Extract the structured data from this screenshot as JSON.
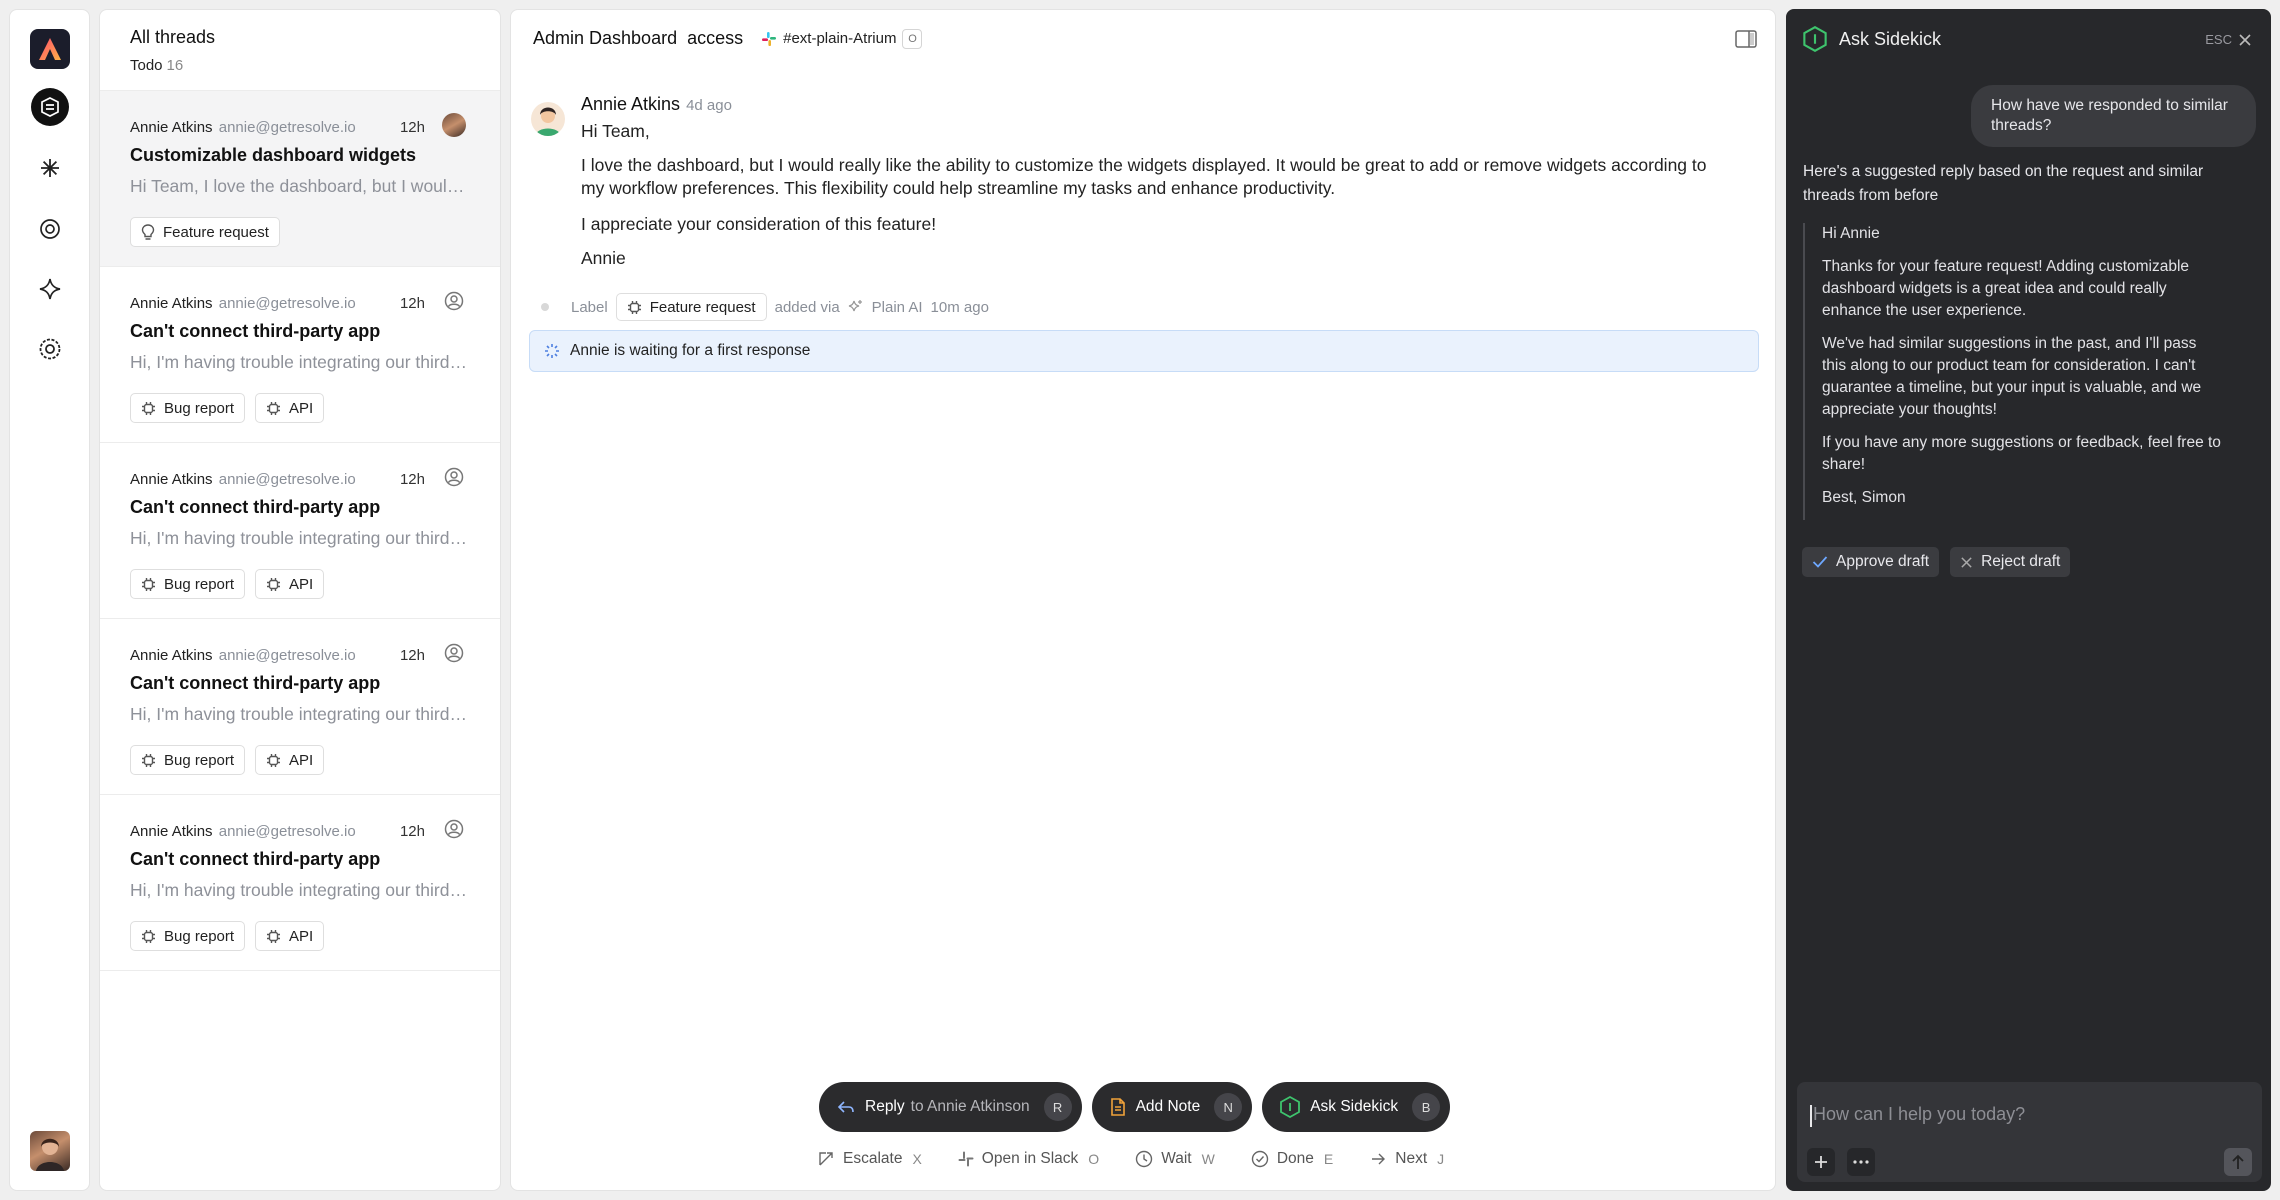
{
  "sidebar": {
    "nav_icons": [
      "logo",
      "inbox-icon",
      "asterisk-icon",
      "gear-icon",
      "sparkle-icon",
      "settings-icon"
    ]
  },
  "threads": {
    "title": "All threads",
    "filter_label": "Todo",
    "filter_count": "16",
    "items": [
      {
        "author": "Annie Atkins",
        "email": "annie@getresolve.io",
        "age": "12h",
        "title": "Customizable dashboard widgets",
        "preview": "Hi Team, I love the dashboard, but I would really like the ability to customize",
        "tags": [
          "Feature request"
        ],
        "selected": true
      },
      {
        "author": "Annie Atkins",
        "email": "annie@getresolve.io",
        "age": "12h",
        "title": "Can't connect third-party app",
        "preview": "Hi, I'm having trouble integrating our third-party app",
        "tags": [
          "Bug report",
          "API"
        ]
      },
      {
        "author": "Annie Atkins",
        "email": "annie@getresolve.io",
        "age": "12h",
        "title": "Can't connect third-party app",
        "preview": "Hi, I'm having trouble integrating our third-party app",
        "tags": [
          "Bug report",
          "API"
        ]
      },
      {
        "author": "Annie Atkins",
        "email": "annie@getresolve.io",
        "age": "12h",
        "title": "Can't connect third-party app",
        "preview": "Hi, I'm having trouble integrating our third-party app",
        "tags": [
          "Bug report",
          "API"
        ]
      },
      {
        "author": "Annie Atkins",
        "email": "annie@getresolve.io",
        "age": "12h",
        "title": "Can't connect third-party app",
        "preview": "Hi, I'm having trouble integrating our third-party app",
        "tags": [
          "Bug report",
          "API"
        ]
      }
    ]
  },
  "conversation": {
    "title": "Admin Dashboard  access",
    "channel": "#ext-plain-Atrium",
    "channel_key": "O",
    "message": {
      "author": "Annie Atkins",
      "ago": "4d ago",
      "greeting": "Hi Team,",
      "para1": "I love the dashboard, but I would really like the ability to customize the widgets displayed. It would be great to add or remove widgets according to my workflow preferences. This flexibility could help streamline my tasks and enhance productivity.",
      "para2": "I appreciate your consideration of this feature!",
      "signoff": "Annie"
    },
    "event": {
      "label": "Label",
      "tag": "Feature request",
      "added_via": "added via",
      "source": "Plain AI",
      "ago": "10m ago"
    },
    "banner": "Annie is waiting for a first response"
  },
  "composer": {
    "reply_label": "Reply",
    "reply_to": "to Annie Atkinson",
    "reply_key": "R",
    "note_label": "Add Note",
    "note_key": "N",
    "sidekick_label": "Ask Sidekick",
    "sidekick_key": "B"
  },
  "actions": [
    {
      "label": "Escalate",
      "key": "X"
    },
    {
      "label": "Open in Slack",
      "key": "O"
    },
    {
      "label": "Wait",
      "key": "W"
    },
    {
      "label": "Done",
      "key": "E"
    },
    {
      "label": "Next",
      "key": "J"
    }
  ],
  "sidekick": {
    "title": "Ask Sidekick",
    "esc": "ESC",
    "user_question": "How have we responded to similar threads?",
    "intro": "Here's a suggested reply based on the request and similar threads from before",
    "draft": [
      "Hi Annie",
      "Thanks for your feature request! Adding customizable dashboard widgets is a great idea and could really enhance the user experience.",
      "We've had similar suggestions in the past, and I'll pass this along to our product team for consideration. I can't guarantee a timeline, but your input is valuable, and we appreciate your thoughts!",
      "If you have any more suggestions or feedback, feel free to share!",
      "Best, Simon"
    ],
    "approve": "Approve draft",
    "reject": "Reject draft",
    "input_placeholder": "How can I help you today?"
  },
  "colors": {
    "accent_green": "#3ec46d",
    "banner_bg": "#eaf2fd",
    "sidekick_bg": "#27282b"
  }
}
